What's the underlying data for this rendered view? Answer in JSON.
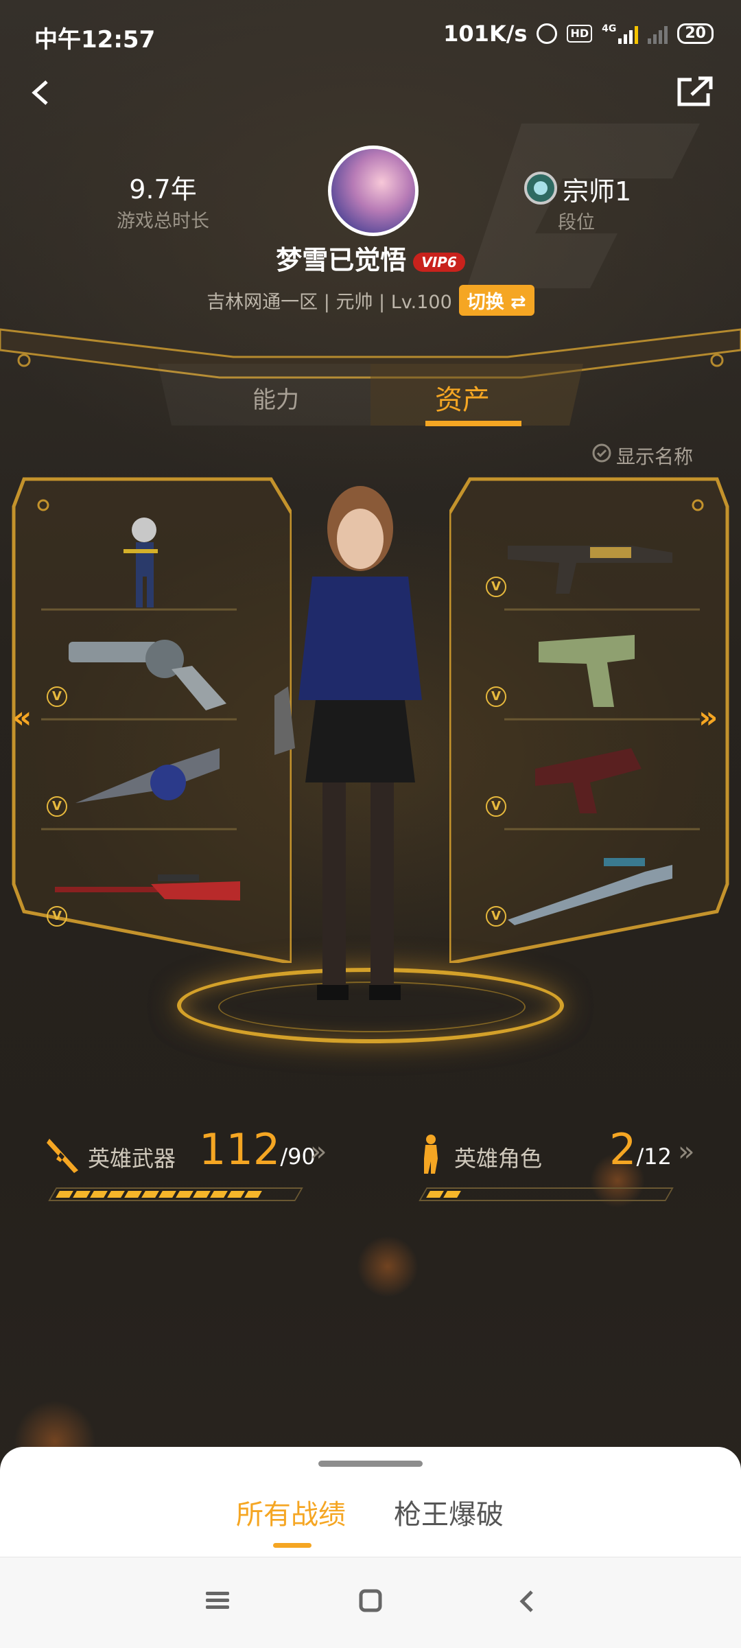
{
  "status_bar": {
    "time": "中午12:57",
    "speed": "101K/s",
    "hd": "HD",
    "network": "4G",
    "battery": "20"
  },
  "header": {
    "back_icon": "back-arrow-icon",
    "share_icon": "share-icon"
  },
  "profile": {
    "play_time_value": "9.7年",
    "play_time_label": "游戏总时长",
    "rank_value": "宗师1",
    "rank_label": "段位",
    "name": "梦雪已觉悟",
    "vip": "VIP6",
    "server_info": "吉林网通一区 | 元帅 | Lv.100",
    "switch_label": "切换 ⇄"
  },
  "tabs": [
    {
      "label": "能力",
      "active": false
    },
    {
      "label": "资产",
      "active": true
    }
  ],
  "locker": {
    "show_names_label": "显示名称",
    "nav_left": "«",
    "nav_right": "»",
    "left_slots": [
      "character",
      "revolver",
      "drum-gun",
      "sniper-red"
    ],
    "right_slots": [
      "smg",
      "pistol-green",
      "pistol-red",
      "sniper-blue"
    ],
    "badge_glyph": "V"
  },
  "collection": {
    "weapons": {
      "label": "英雄武器",
      "owned": "112",
      "total": "/90",
      "arrow": "»",
      "segments": 12
    },
    "roles": {
      "label": "英雄角色",
      "owned": "2",
      "total": "/12",
      "arrow": "»",
      "segments": 2
    }
  },
  "bottom_sheet": {
    "tabs": [
      {
        "label": "所有战绩",
        "active": true
      },
      {
        "label": "枪王爆破",
        "active": false
      }
    ]
  },
  "colors": {
    "accent": "#f5a623",
    "gold": "#d4a12a",
    "vip_red": "#c9221c"
  }
}
